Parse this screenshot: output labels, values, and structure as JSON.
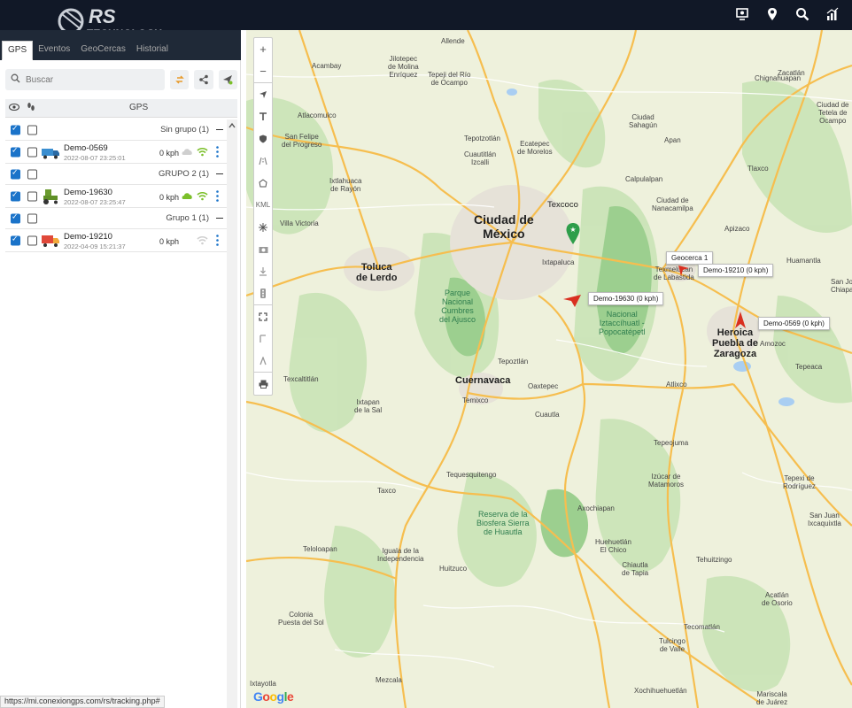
{
  "brand": {
    "logo_text": "RS",
    "logo_sub": "TECHNOLOGY"
  },
  "topbar": {
    "icons": [
      "monitor-icon",
      "location-pin-icon",
      "search-icon",
      "report-chart-icon"
    ]
  },
  "tabs": [
    {
      "label": "GPS",
      "active": true
    },
    {
      "label": "Eventos",
      "active": false
    },
    {
      "label": "GeoCercas",
      "active": false
    },
    {
      "label": "Historial",
      "active": false
    }
  ],
  "search": {
    "placeholder": "Buscar"
  },
  "list_header": {
    "gps": "GPS"
  },
  "groups": [
    {
      "label": "Sin grupo (1)",
      "device": {
        "name": "Demo-0569",
        "time": "2022-08-07 23:25:01",
        "speed": "0 kph",
        "vehicle": "truck-blue"
      }
    },
    {
      "label": "GRUPO 2 (1)",
      "device": {
        "name": "Demo-19630",
        "time": "2022-08-07 23:25:47",
        "speed": "0 kph",
        "vehicle": "tractor-green"
      }
    },
    {
      "label": "Grupo 1 (1)",
      "device": {
        "name": "Demo-19210",
        "time": "2022-04-09 15:21:37",
        "speed": "0 kph",
        "vehicle": "truck-red"
      }
    }
  ],
  "status_url": "https://mi.conexiongps.com/rs/tracking.php#",
  "map": {
    "labels": {
      "ciudad_mexico": "Ciudad de\nMéxico",
      "toluca": "Toluca\nde Lerdo",
      "cuernavaca": "Cuernavaca",
      "puebla": "Heroica\nPuebla de\nZaragoza",
      "texcoco": "Texcoco",
      "allende": "Allende",
      "acambay": "Acambay",
      "jilotepec": "Jilotepec\nde Molina\nEnríquez",
      "tepeji": "Tepeji del Río\nde Ocampo",
      "sahagun": "Ciudad\nSahagún",
      "apan": "Apan",
      "chignahuapan": "Chignahuapan",
      "tetela": "Ciudad de\nTetela de\nOcampo",
      "zacatlan": "Zacatlán",
      "atlacomulco": "Atlacomulco",
      "san_felipe": "San Felipe\ndel Progreso",
      "tepotzotlan": "Tepotzotlán",
      "cuautitlan": "Cuautitlán\nIzcalli",
      "ecatepec": "Ecatepec\nde Morelos",
      "calpulalpan": "Calpulalpan",
      "nanacamilpa": "Ciudad de\nNanacamilpa",
      "tlaxco": "Tlaxco",
      "apizaco": "Apizaco",
      "huamantla": "Huamantla",
      "ixtlahuaca": "Ixtlahuaca\nde Rayón",
      "villa_victoria": "Villa Victoria",
      "ixtapaluca": "Ixtapaluca",
      "texmelucan": "Texmelucan\nde Labastida",
      "amozoc": "Amozoc",
      "tepeaca": "Tepeaca",
      "parque_ajusco": "Parque\nNacional\nCumbres\ndel Ajusco",
      "izta_popo": "Nacional\nIztaccíhuatl -\nPopocatépetl",
      "tepoztlan": "Tepoztlán",
      "oaxtepec": "Oaxtepec",
      "atlixco": "Atlixco",
      "texcaltitlan": "Texcaltitlán",
      "ixtapan": "Ixtapan\nde la Sal",
      "temixco": "Temixco",
      "cuautla": "Cuautla",
      "tepeojuma": "Tepeojuma",
      "matamoros": "Izúcar de\nMatamoros",
      "tepexi": "Tepexi de\nRodríguez",
      "taxco": "Taxco",
      "tequesquitengo": "Tequesquitengo",
      "axochiapan": "Axochiapan",
      "reserva": "Reserva de la\nBiosfera Sierra\nde Huautla",
      "san_juan": "San Juan\nIxcaquixtla",
      "teloloapan": "Teloloapan",
      "iguala": "Iguala de la\nIndependencia",
      "huitzuco": "Huitzuco",
      "huehuetlan": "Huehuetlán\nEl Chico",
      "chiautla": "Chiautla\nde Tapia",
      "tehuitzingo": "Tehuitzingo",
      "colonia": "Colonia\nPuesta del Sol",
      "acatlan": "Acatlán\nde Osorio",
      "tecomatlan": "Tecomatlán",
      "tulcingo": "Tulcingo\nde Valle",
      "ixtayotla": "Ixtayotla",
      "mezcala": "Mezcala",
      "chiucuehuetlan": "Xochihuehuetlán",
      "mariscala": "Mariscala\nde Juárez",
      "san_jose": "San Jo\nChiapa"
    },
    "markers": [
      {
        "label": "Geocerca 1",
        "color": "#2e9e4a"
      },
      {
        "label": "Demo-19210 (0 kph)",
        "color": "#d92f20"
      },
      {
        "label": "Demo-19630 (0 kph)",
        "color": "#d92f20"
      },
      {
        "label": "Demo-0569 (0 kph)",
        "color": "#d92f20"
      }
    ],
    "google_logo": "Google"
  }
}
